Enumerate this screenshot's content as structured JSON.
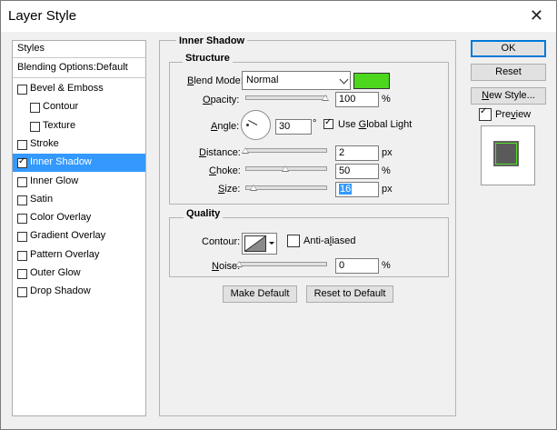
{
  "window": {
    "title": "Layer Style",
    "close_glyph": "✕"
  },
  "styles_panel": {
    "header": "Styles",
    "blending_options": "Blending Options:Default",
    "items": [
      {
        "label": "Bevel & Emboss",
        "checked": false,
        "selected": false,
        "indent": false
      },
      {
        "label": "Contour",
        "checked": false,
        "selected": false,
        "indent": true
      },
      {
        "label": "Texture",
        "checked": false,
        "selected": false,
        "indent": true
      },
      {
        "label": "Stroke",
        "checked": false,
        "selected": false,
        "indent": false
      },
      {
        "label": "Inner Shadow",
        "checked": true,
        "selected": true,
        "indent": false
      },
      {
        "label": "Inner Glow",
        "checked": false,
        "selected": false,
        "indent": false
      },
      {
        "label": "Satin",
        "checked": false,
        "selected": false,
        "indent": false
      },
      {
        "label": "Color Overlay",
        "checked": false,
        "selected": false,
        "indent": false
      },
      {
        "label": "Gradient Overlay",
        "checked": false,
        "selected": false,
        "indent": false
      },
      {
        "label": "Pattern Overlay",
        "checked": false,
        "selected": false,
        "indent": false
      },
      {
        "label": "Outer Glow",
        "checked": false,
        "selected": false,
        "indent": false
      },
      {
        "label": "Drop Shadow",
        "checked": false,
        "selected": false,
        "indent": false
      }
    ]
  },
  "inner_shadow": {
    "section_title": "Inner Shadow",
    "structure": {
      "title": "Structure",
      "blend_mode_label_u": "B",
      "blend_mode_label_rest": "lend Mode:",
      "blend_mode_value": "Normal",
      "color": "#4cd61e",
      "opacity_label_u": "O",
      "opacity_label_rest": "pacity:",
      "opacity_value": "100",
      "opacity_unit": "%",
      "opacity_level": 1.0,
      "angle_label_u": "A",
      "angle_label_rest": "ngle:",
      "angle_value": "30",
      "angle_unit": "°",
      "use_global_light_u": "G",
      "use_global_light_pre": "Use ",
      "use_global_light_post": "lobal Light",
      "use_global_light_checked": true,
      "distance_label_u": "D",
      "distance_label_rest": "istance:",
      "distance_value": "2",
      "distance_unit": "px",
      "distance_level": 0.0,
      "choke_label_u": "C",
      "choke_label_rest": "hoke:",
      "choke_value": "50",
      "choke_unit": "%",
      "choke_level": 0.5,
      "size_label_u": "S",
      "size_label_rest": "ize:",
      "size_value": "16",
      "size_unit": "px",
      "size_level": 0.1
    },
    "quality": {
      "title": "Quality",
      "contour_label": "Contour:",
      "anti_aliased_pre": "Anti-a",
      "anti_aliased_u": "l",
      "anti_aliased_post": "iased",
      "anti_aliased_checked": false,
      "noise_label_u": "N",
      "noise_label_rest": "oise:",
      "noise_value": "0",
      "noise_unit": "%",
      "noise_level": 0.0
    },
    "make_default": "Make Default",
    "reset_to_default": "Reset to Default"
  },
  "buttons": {
    "ok": "OK",
    "reset": "Reset",
    "new_style_u": "N",
    "new_style_rest": "ew Style...",
    "preview_pre": "Pre",
    "preview_u": "v",
    "preview_post": "iew",
    "preview_checked": true
  }
}
